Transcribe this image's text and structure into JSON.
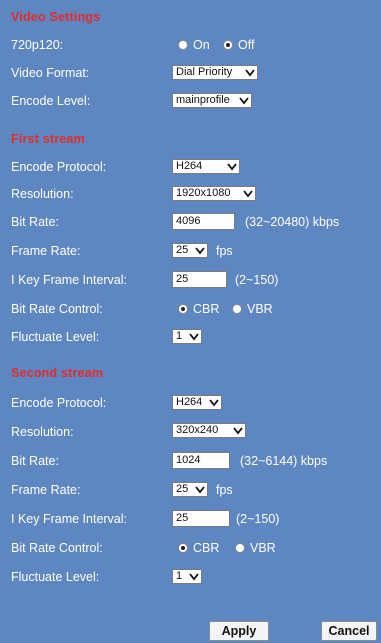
{
  "video_settings": {
    "title": "Video Settings",
    "p720p120": {
      "label": "720p120:",
      "on_label": "On",
      "off_label": "Off",
      "selected": "Off"
    },
    "video_format": {
      "label": "Video Format:",
      "value": "Dial Priority"
    },
    "encode_level": {
      "label": "Encode Level:",
      "value": "mainprofile"
    }
  },
  "first_stream": {
    "title": "First stream",
    "encode_protocol": {
      "label": "Encode Protocol:",
      "value": "H264"
    },
    "resolution": {
      "label": "Resolution:",
      "value": "1920x1080"
    },
    "bit_rate": {
      "label": "Bit Rate:",
      "value": "4096",
      "range": "(32~20480) kbps"
    },
    "frame_rate": {
      "label": "Frame Rate:",
      "value": "25",
      "unit": "fps"
    },
    "key_frame": {
      "label": "I Key Frame Interval:",
      "value": "25",
      "range": "(2~150)"
    },
    "bit_rate_control": {
      "label": "Bit Rate Control:",
      "cbr_label": "CBR",
      "vbr_label": "VBR",
      "selected": "CBR"
    },
    "fluctuate": {
      "label": "Fluctuate Level:",
      "value": "1"
    }
  },
  "second_stream": {
    "title": "Second stream",
    "encode_protocol": {
      "label": "Encode Protocol:",
      "value": "H264"
    },
    "resolution": {
      "label": "Resolution:",
      "value": "320x240"
    },
    "bit_rate": {
      "label": "Bit Rate:",
      "value": "1024",
      "range": "(32~6144) kbps"
    },
    "frame_rate": {
      "label": "Frame Rate:",
      "value": "25",
      "unit": "fps"
    },
    "key_frame": {
      "label": "I Key Frame Interval:",
      "value": "25",
      "range": "(2~150)"
    },
    "bit_rate_control": {
      "label": "Bit Rate Control:",
      "cbr_label": "CBR",
      "vbr_label": "VBR",
      "selected": "CBR"
    },
    "fluctuate": {
      "label": "Fluctuate Level:",
      "value": "1"
    }
  },
  "buttons": {
    "apply": "Apply",
    "cancel": "Cancel"
  },
  "colors": {
    "panel_bg": "#5e86c0",
    "section_title": "#e32d2d",
    "label": "#ffffff"
  }
}
